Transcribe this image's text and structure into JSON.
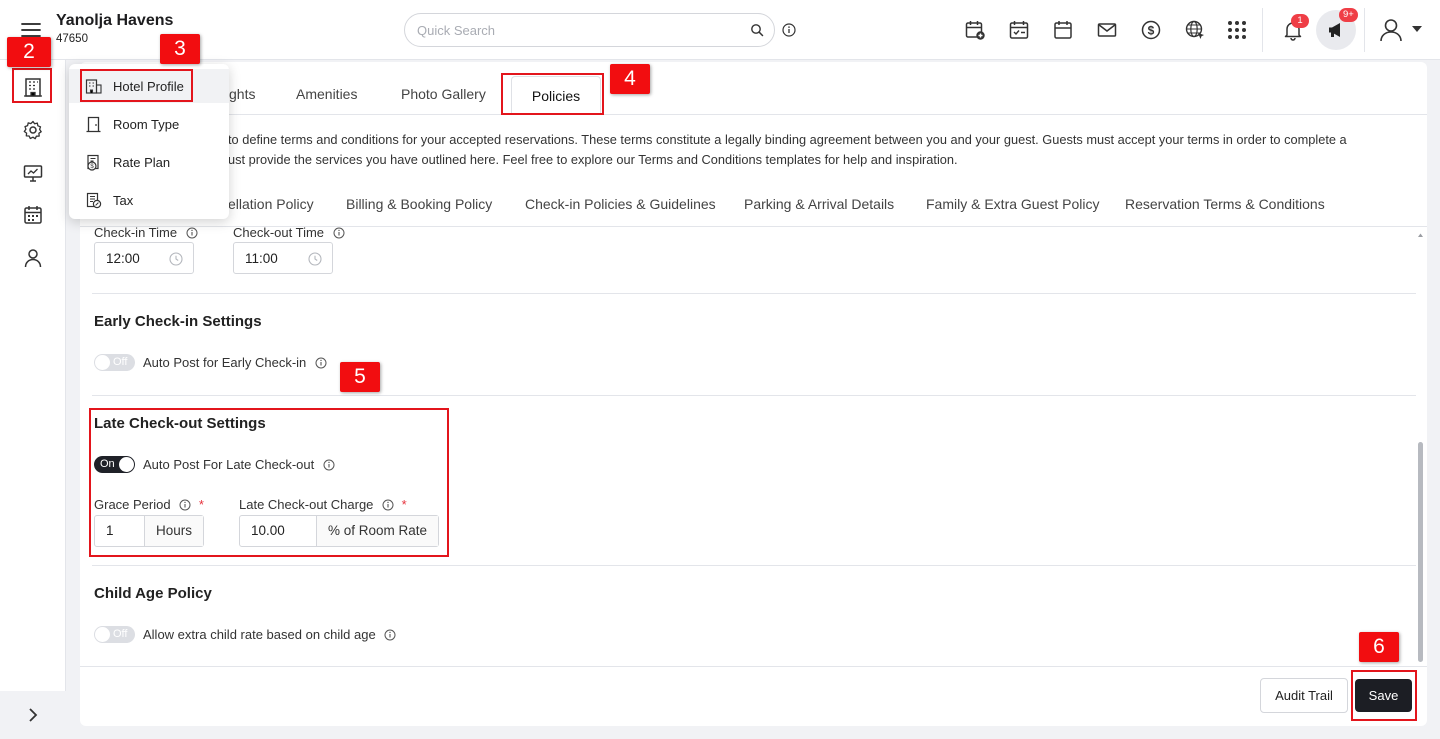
{
  "header": {
    "hotel_name": "Yanolja Havens",
    "hotel_id": "47650",
    "search_placeholder": "Quick Search",
    "notification_count": "1",
    "announcement_count": "9+"
  },
  "dropdown": {
    "items": [
      {
        "label": "Hotel Profile",
        "icon": "hotel-profile-icon"
      },
      {
        "label": "Room Type",
        "icon": "door-icon"
      },
      {
        "label": "Rate Plan",
        "icon": "rate-plan-icon"
      },
      {
        "label": "Tax",
        "icon": "tax-icon"
      }
    ]
  },
  "tabs": {
    "partial": "ghts",
    "amenities": "Amenities",
    "photo_gallery": "Photo Gallery",
    "policies": "Policies"
  },
  "description": {
    "line1": "to define terms and conditions for your accepted reservations. These terms constitute a legally binding agreement between you and your guest. Guests must accept your terms in order to complete a",
    "line2": "ust provide the services you have outlined here. Feel free to explore our Terms and Conditions templates for help and inspiration."
  },
  "subtabs": {
    "cancellation": "ellation Policy",
    "billing": "Billing & Booking Policy",
    "checkin": "Check-in Policies & Guidelines",
    "parking": "Parking & Arrival Details",
    "family": "Family & Extra Guest Policy",
    "reservation": "Reservation Terms & Conditions"
  },
  "checkin_time": {
    "label": "Check-in Time",
    "value": "12:00"
  },
  "checkout_time": {
    "label": "Check-out Time",
    "value": "11:00"
  },
  "early_checkin": {
    "title": "Early Check-in Settings",
    "toggle_state": "Off",
    "toggle_label": "Auto Post for Early Check-in"
  },
  "late_checkout": {
    "title": "Late Check-out Settings",
    "toggle_state": "On",
    "toggle_label": "Auto Post For Late Check-out",
    "grace_label": "Grace Period",
    "grace_value": "1",
    "grace_unit": "Hours",
    "charge_label": "Late Check-out Charge",
    "charge_value": "10.00",
    "charge_unit": "% of Room Rate",
    "required_mark": "*"
  },
  "child_age": {
    "title": "Child Age Policy",
    "toggle_state": "Off",
    "toggle_label": "Allow extra child rate based on child age"
  },
  "footer": {
    "audit_trail": "Audit Trail",
    "save": "Save"
  },
  "annotations": [
    "2",
    "3",
    "4",
    "5",
    "6"
  ],
  "colors": {
    "annotation": "#e3151c",
    "primary_button": "#1c1e24",
    "badge": "#ef3e46"
  }
}
